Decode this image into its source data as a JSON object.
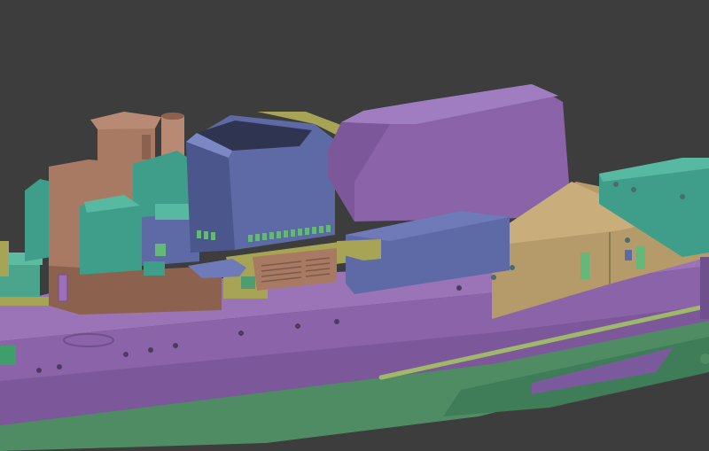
{
  "scene": {
    "background": "#3d3d3d",
    "colors": {
      "hull_purple": "#8a63a8",
      "hull_purple_dark": "#6f4f8c",
      "hull_purple_light": "#a07cc0",
      "blue_slate": "#5d6aa6",
      "blue_slate_dark": "#4b568c",
      "teal": "#3f9e8a",
      "teal_light": "#57b9a2",
      "brown": "#a87a63",
      "brown_dark": "#8c624f",
      "olive": "#a8a456",
      "olive_dark": "#8a8740",
      "tan": "#b59a6a",
      "green_hull": "#4f8c64",
      "rail": "#9fb86a"
    }
  }
}
